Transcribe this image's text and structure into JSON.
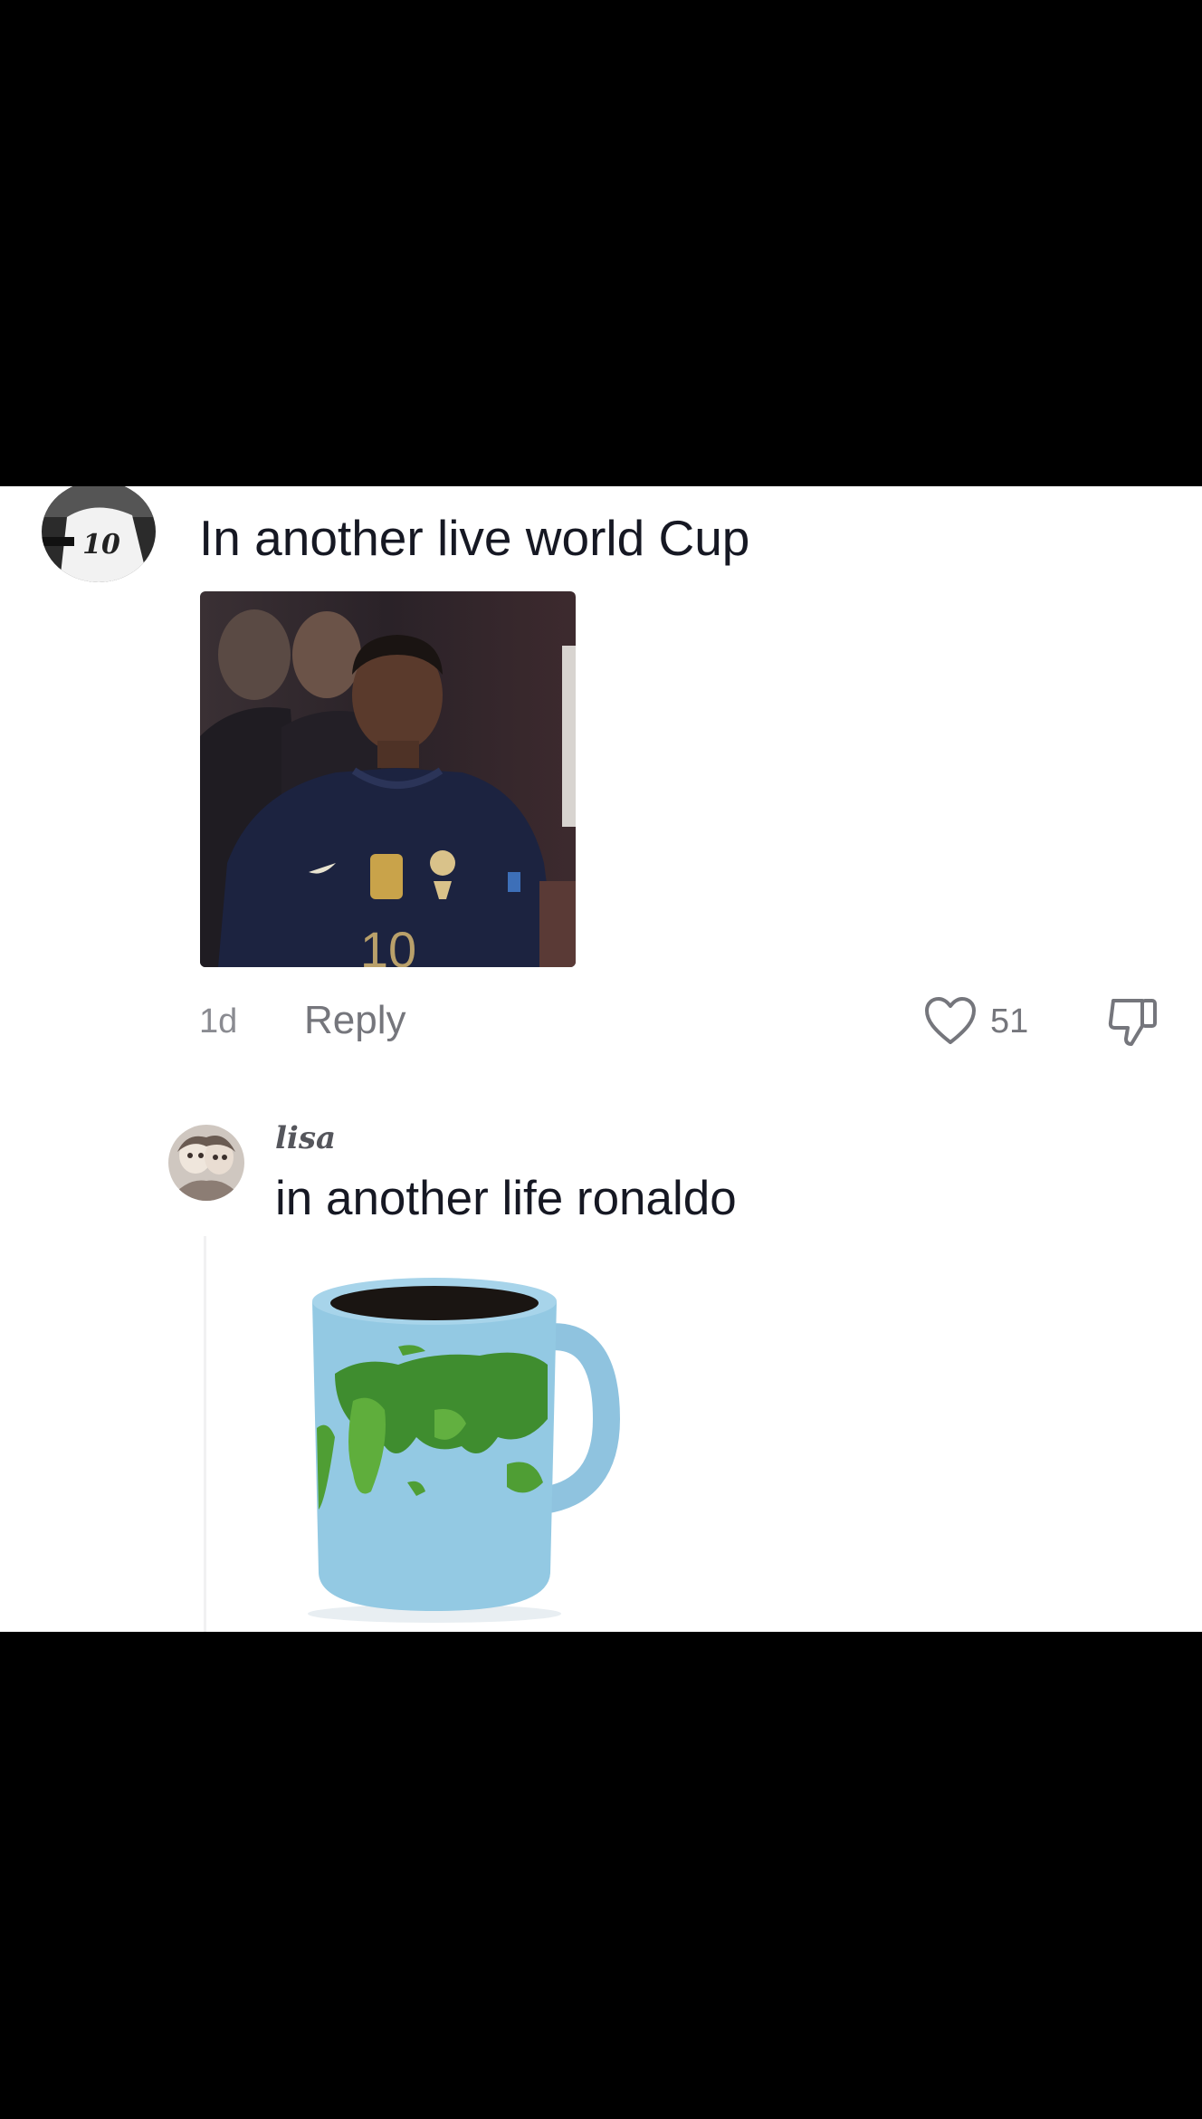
{
  "comment": {
    "avatar_icon": "user-avatar-jersey-icon",
    "avatar_jersey_number": "10",
    "text": "In another live world Cup",
    "image_jersey_number": "10",
    "time": "1d",
    "reply_label": "Reply",
    "likes": "51"
  },
  "reply": {
    "avatar_icon": "user-avatar-icon",
    "username": "lisa",
    "text": "in another life ronaldo",
    "image_icon": "world-map-mug-icon"
  },
  "colors": {
    "text_primary": "#161823",
    "text_secondary": "#75767c",
    "background": "#ffffff",
    "letterbox": "#000000"
  }
}
